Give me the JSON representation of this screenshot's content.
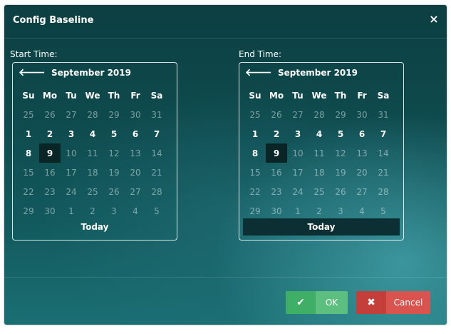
{
  "dialog": {
    "title": "Config Baseline",
    "close_icon": "×"
  },
  "start": {
    "label": "Start Time:",
    "month": "September 2019",
    "prev_icon": "🡐",
    "weekdays": [
      "Su",
      "Mo",
      "Tu",
      "We",
      "Th",
      "Fr",
      "Sa"
    ],
    "days": [
      {
        "d": "25",
        "s": "muted"
      },
      {
        "d": "26",
        "s": "muted"
      },
      {
        "d": "27",
        "s": "muted"
      },
      {
        "d": "28",
        "s": "muted"
      },
      {
        "d": "29",
        "s": "muted"
      },
      {
        "d": "30",
        "s": "muted"
      },
      {
        "d": "31",
        "s": "muted"
      },
      {
        "d": "1",
        "s": "avail"
      },
      {
        "d": "2",
        "s": "avail"
      },
      {
        "d": "3",
        "s": "avail"
      },
      {
        "d": "4",
        "s": "avail"
      },
      {
        "d": "5",
        "s": "avail"
      },
      {
        "d": "6",
        "s": "avail"
      },
      {
        "d": "7",
        "s": "avail"
      },
      {
        "d": "8",
        "s": "avail"
      },
      {
        "d": "9",
        "s": "sel"
      },
      {
        "d": "10",
        "s": "muted"
      },
      {
        "d": "11",
        "s": "muted"
      },
      {
        "d": "12",
        "s": "muted"
      },
      {
        "d": "13",
        "s": "muted"
      },
      {
        "d": "14",
        "s": "muted"
      },
      {
        "d": "15",
        "s": "muted"
      },
      {
        "d": "16",
        "s": "muted"
      },
      {
        "d": "17",
        "s": "muted"
      },
      {
        "d": "18",
        "s": "muted"
      },
      {
        "d": "19",
        "s": "muted"
      },
      {
        "d": "20",
        "s": "muted"
      },
      {
        "d": "21",
        "s": "muted"
      },
      {
        "d": "22",
        "s": "muted"
      },
      {
        "d": "23",
        "s": "muted"
      },
      {
        "d": "24",
        "s": "muted"
      },
      {
        "d": "25",
        "s": "muted"
      },
      {
        "d": "26",
        "s": "muted"
      },
      {
        "d": "27",
        "s": "muted"
      },
      {
        "d": "28",
        "s": "muted"
      },
      {
        "d": "29",
        "s": "muted"
      },
      {
        "d": "30",
        "s": "muted"
      },
      {
        "d": "1",
        "s": "muted"
      },
      {
        "d": "2",
        "s": "muted"
      },
      {
        "d": "3",
        "s": "muted"
      },
      {
        "d": "4",
        "s": "muted"
      },
      {
        "d": "5",
        "s": "muted"
      }
    ],
    "today_label": "Today"
  },
  "end": {
    "label": "End Time:",
    "month": "September 2019",
    "prev_icon": "🡐",
    "weekdays": [
      "Su",
      "Mo",
      "Tu",
      "We",
      "Th",
      "Fr",
      "Sa"
    ],
    "days": [
      {
        "d": "25",
        "s": "muted"
      },
      {
        "d": "26",
        "s": "muted"
      },
      {
        "d": "27",
        "s": "muted"
      },
      {
        "d": "28",
        "s": "muted"
      },
      {
        "d": "29",
        "s": "muted"
      },
      {
        "d": "30",
        "s": "muted"
      },
      {
        "d": "31",
        "s": "muted"
      },
      {
        "d": "1",
        "s": "avail"
      },
      {
        "d": "2",
        "s": "avail"
      },
      {
        "d": "3",
        "s": "avail"
      },
      {
        "d": "4",
        "s": "avail"
      },
      {
        "d": "5",
        "s": "avail"
      },
      {
        "d": "6",
        "s": "avail"
      },
      {
        "d": "7",
        "s": "avail"
      },
      {
        "d": "8",
        "s": "avail"
      },
      {
        "d": "9",
        "s": "sel"
      },
      {
        "d": "10",
        "s": "muted"
      },
      {
        "d": "11",
        "s": "muted"
      },
      {
        "d": "12",
        "s": "muted"
      },
      {
        "d": "13",
        "s": "muted"
      },
      {
        "d": "14",
        "s": "muted"
      },
      {
        "d": "15",
        "s": "muted"
      },
      {
        "d": "16",
        "s": "muted"
      },
      {
        "d": "17",
        "s": "muted"
      },
      {
        "d": "18",
        "s": "muted"
      },
      {
        "d": "19",
        "s": "muted"
      },
      {
        "d": "20",
        "s": "muted"
      },
      {
        "d": "21",
        "s": "muted"
      },
      {
        "d": "22",
        "s": "muted"
      },
      {
        "d": "23",
        "s": "muted"
      },
      {
        "d": "24",
        "s": "muted"
      },
      {
        "d": "25",
        "s": "muted"
      },
      {
        "d": "26",
        "s": "muted"
      },
      {
        "d": "27",
        "s": "muted"
      },
      {
        "d": "28",
        "s": "muted"
      },
      {
        "d": "29",
        "s": "muted"
      },
      {
        "d": "30",
        "s": "muted"
      },
      {
        "d": "1",
        "s": "muted"
      },
      {
        "d": "2",
        "s": "muted"
      },
      {
        "d": "3",
        "s": "muted"
      },
      {
        "d": "4",
        "s": "muted"
      },
      {
        "d": "5",
        "s": "muted"
      }
    ],
    "today_label": "Today"
  },
  "buttons": {
    "ok_label": "OK",
    "ok_icon": "✔",
    "cancel_label": "Cancel",
    "cancel_icon": "✖"
  },
  "colors": {
    "ok": "#5cbf7f",
    "cancel": "#d9534f",
    "selected_day": "#0a2526"
  }
}
